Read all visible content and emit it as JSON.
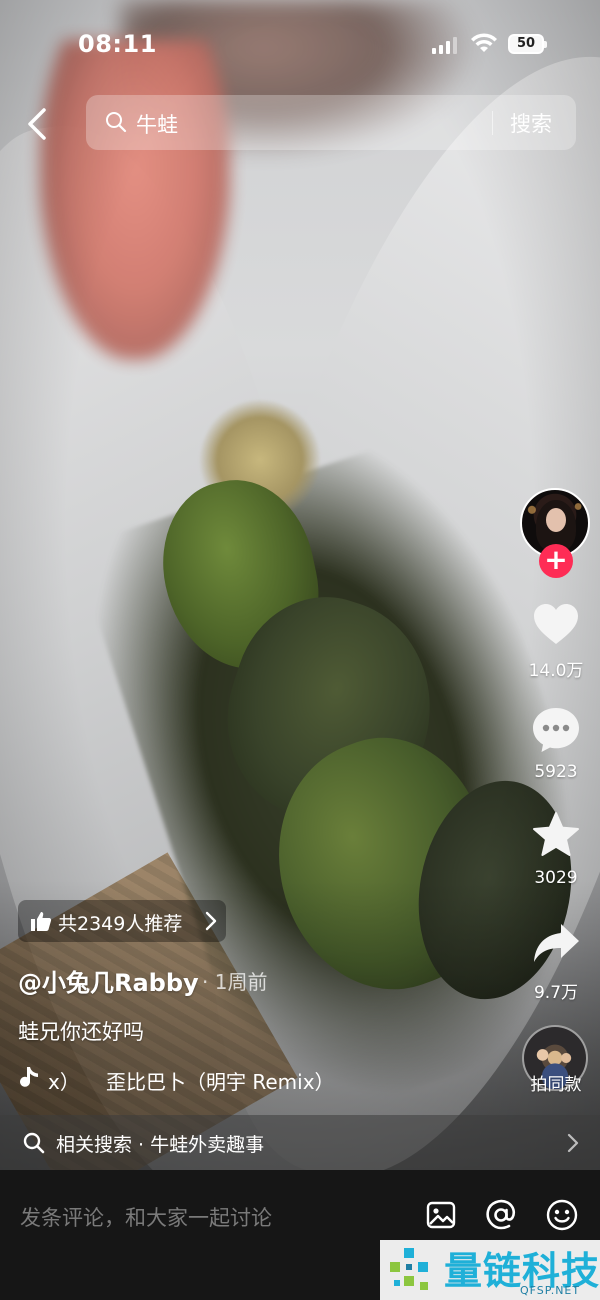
{
  "status_bar": {
    "time": "08:11",
    "battery": "50"
  },
  "search": {
    "query": "牛蛙",
    "button_label": "搜索"
  },
  "right_rail": {
    "likes": "14.0万",
    "comments": "5923",
    "favorites": "3029",
    "shares": "9.7万",
    "same_style_label": "拍同款"
  },
  "video": {
    "recommend_pill": "共2349人推荐",
    "author": "@小兔几Rabby",
    "posted_ago": "· 1周前",
    "caption": "蛙兄你还好吗",
    "music_prefix": "x）",
    "music_title": "歪比巴卜（明宇 Remix）"
  },
  "related_search": {
    "text": "相关搜索 · 牛蛙外卖趣事"
  },
  "comment_bar": {
    "placeholder": "发条评论，和大家一起讨论"
  },
  "watermark": {
    "name": "量链科技",
    "domain": "QFSP.NET"
  },
  "colors": {
    "follow_red": "#fe2c55",
    "watermark_blue": "#1fb0d8"
  },
  "icons": {
    "back": "chevron-left-icon",
    "search": "search-icon",
    "like": "heart-icon",
    "comment": "chat-bubble-icon",
    "favorite": "star-icon",
    "share": "share-arrow-icon",
    "music": "music-note-icon",
    "image": "image-icon",
    "mention": "at-icon",
    "emoji": "emoji-icon"
  }
}
